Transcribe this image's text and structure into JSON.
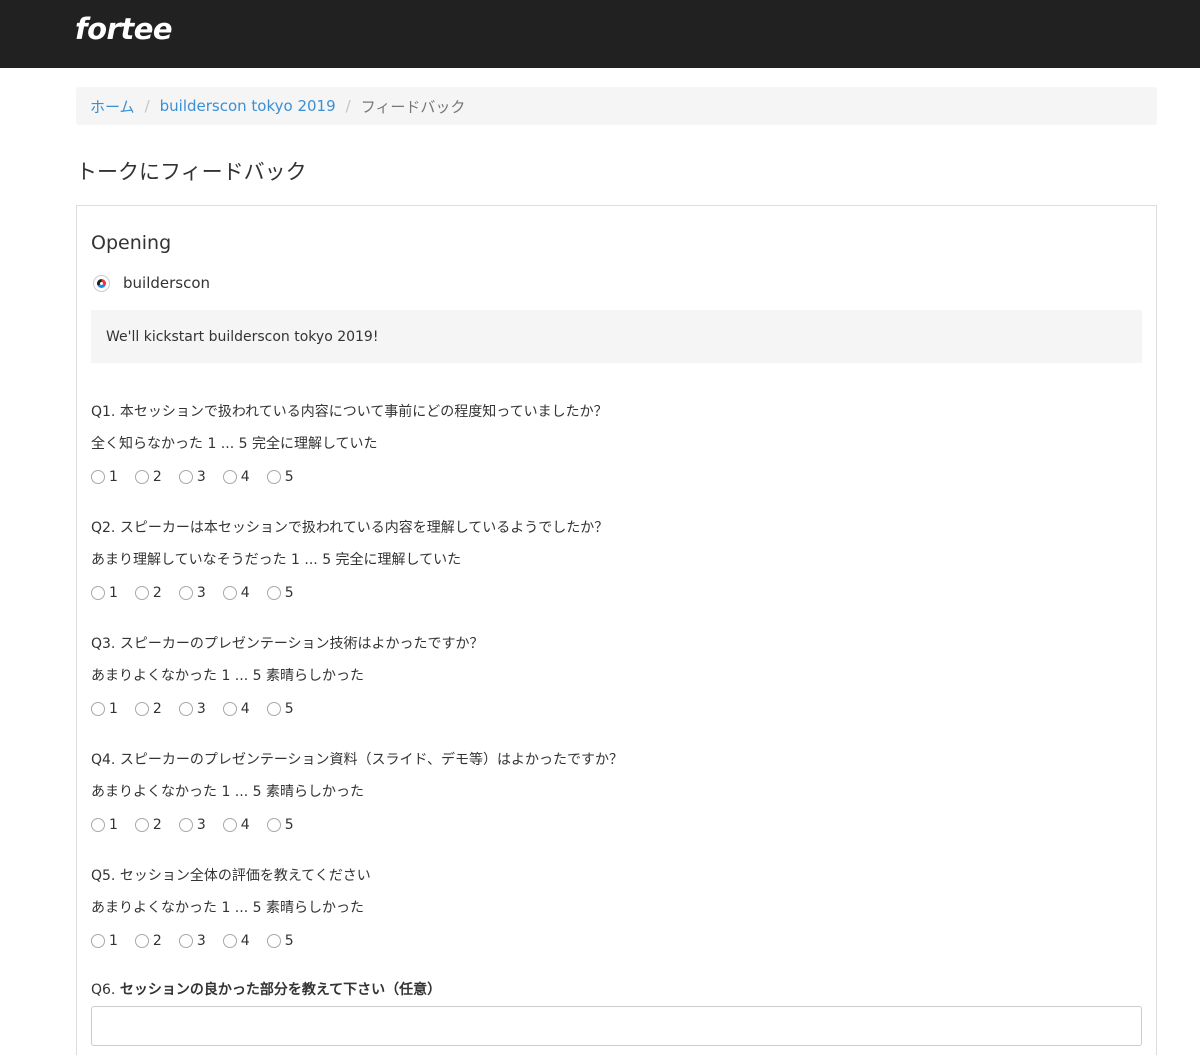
{
  "brand": "fortee",
  "breadcrumb": {
    "home": "ホーム",
    "event": "builderscon tokyo 2019",
    "current": "フィードバック",
    "separator": "/"
  },
  "page_title": "トークにフィードバック",
  "talk": {
    "title": "Opening",
    "speaker": "builderscon",
    "abstract": "We'll kickstart builderscon tokyo 2019!"
  },
  "questions": [
    {
      "text": "Q1. 本セッションで扱われている内容について事前にどの程度知っていましたか？",
      "scale": "全く知らなかった 1 ... 5 完全に理解していた",
      "options": [
        "1",
        "2",
        "3",
        "4",
        "5"
      ]
    },
    {
      "text": "Q2. スピーカーは本セッションで扱われている内容を理解しているようでしたか？",
      "scale": "あまり理解していなそうだった 1 ... 5 完全に理解していた",
      "options": [
        "1",
        "2",
        "3",
        "4",
        "5"
      ]
    },
    {
      "text": "Q3. スピーカーのプレゼンテーション技術はよかったですか？",
      "scale": "あまりよくなかった 1 ... 5 素晴らしかった",
      "options": [
        "1",
        "2",
        "3",
        "4",
        "5"
      ]
    },
    {
      "text": "Q4. スピーカーのプレゼンテーション資料（スライド、デモ等）はよかったですか？",
      "scale": "あまりよくなかった 1 ... 5 素晴らしかった",
      "options": [
        "1",
        "2",
        "3",
        "4",
        "5"
      ]
    },
    {
      "text": "Q5. セッション全体の評価を教えてください",
      "scale": "あまりよくなかった 1 ... 5 素晴らしかった",
      "options": [
        "1",
        "2",
        "3",
        "4",
        "5"
      ]
    }
  ],
  "q6": {
    "prefix": "Q6. ",
    "label": "セッションの良かった部分を教えて下さい（任意）"
  }
}
